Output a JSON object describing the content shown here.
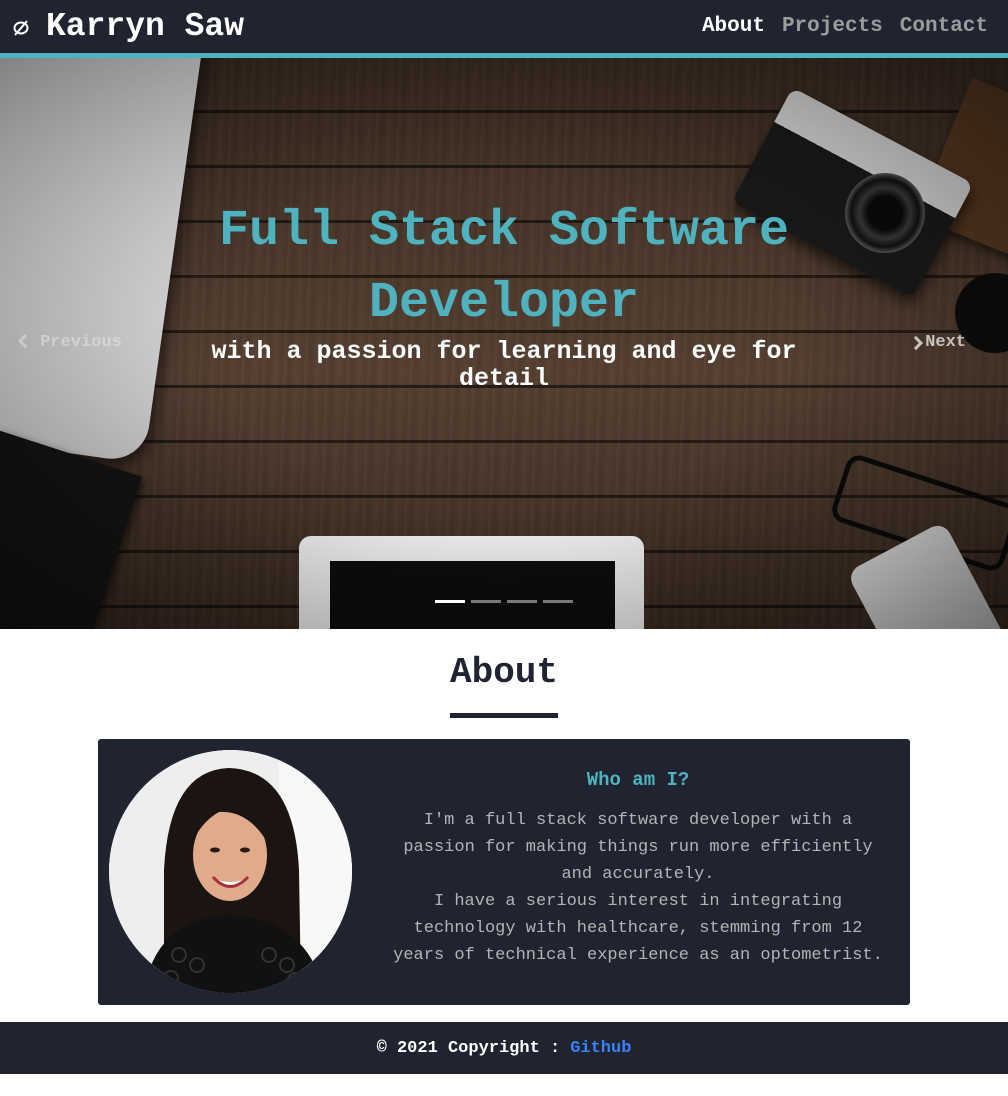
{
  "navbar": {
    "brand_icon": "leaf-icon",
    "brand_name": "Karryn Saw",
    "links": [
      {
        "label": "About",
        "active": true
      },
      {
        "label": "Projects",
        "active": false
      },
      {
        "label": "Contact",
        "active": false
      }
    ]
  },
  "hero": {
    "title": "Full Stack Software Developer",
    "subtitle": "with a passion for learning and eye for detail",
    "prev_label": "Previous",
    "next_label": "Next",
    "slide_count": 4,
    "active_slide": 1
  },
  "about": {
    "heading": "About",
    "card_title": "Who am I?",
    "bio_paragraph_1": "I'm a full stack software developer with a passion for making things run more efficiently and accurately.",
    "bio_paragraph_2": "I have a serious interest in integrating technology with healthcare, stemming from 12 years of technical experience as an optometrist."
  },
  "footer": {
    "copyright": "© 2021 Copyright :",
    "link_label": "Github"
  },
  "colors": {
    "navy": "#1f2430",
    "accent": "#4fb3bf",
    "link_blue": "#3b82f6"
  }
}
